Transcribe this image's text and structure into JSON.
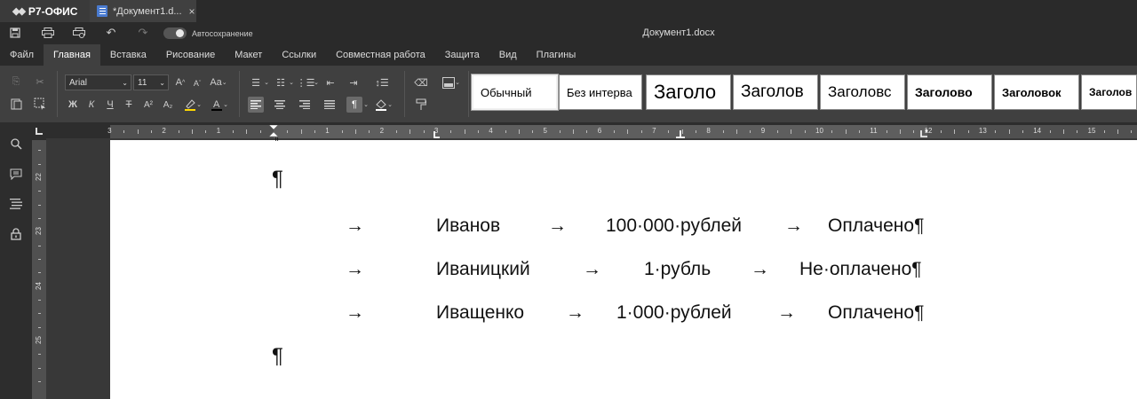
{
  "titlebar": {
    "logo": "Р7-ОФИС",
    "doc_tab": "*Документ1.d...",
    "close": "×"
  },
  "quickaccess": {
    "autosave_label": "Автосохранение",
    "window_title": "Документ1.docx"
  },
  "tabs": [
    "Файл",
    "Главная",
    "Вставка",
    "Рисование",
    "Макет",
    "Ссылки",
    "Совместная работа",
    "Защита",
    "Вид",
    "Плагины"
  ],
  "toolbar": {
    "font_name": "Arial",
    "font_size": "11",
    "bold": "Ж",
    "italic": "К",
    "underline": "Ч",
    "strike": "Т",
    "superscript": "A²",
    "subscript": "A₂",
    "grow_font": "A",
    "shrink_font": "A",
    "change_case": "Aa"
  },
  "styles": [
    "Обычный",
    "Без интерва",
    "Заголо",
    "Заголов",
    "Заголовс",
    "Заголово",
    "Заголовок",
    "Заголов"
  ],
  "ruler_numbers": [
    "3",
    "2",
    "1",
    "1",
    "2",
    "3",
    "4",
    "5",
    "6",
    "7",
    "8",
    "9",
    "10",
    "11",
    "12",
    "13",
    "14",
    "15"
  ],
  "vruler_numbers": [
    "22",
    "23",
    "24",
    "25",
    "26"
  ],
  "document": {
    "empty_para_top": "¶",
    "rows": [
      {
        "arrow1": "→",
        "name": "Иванов",
        "arrow2": "→",
        "amount": "100·000·рублей",
        "arrow3": "→",
        "status": "Оплачено¶"
      },
      {
        "arrow1": "→",
        "name": "Иваницкий",
        "arrow2": "→",
        "amount": "1·рубль",
        "arrow3": "→",
        "status": "Не·оплачено¶"
      },
      {
        "arrow1": "→",
        "name": "Иващенко",
        "arrow2": "→",
        "amount": "1·000·рублей",
        "arrow3": "→",
        "status": "Оплачено¶"
      }
    ],
    "empty_para_bottom": "¶"
  }
}
